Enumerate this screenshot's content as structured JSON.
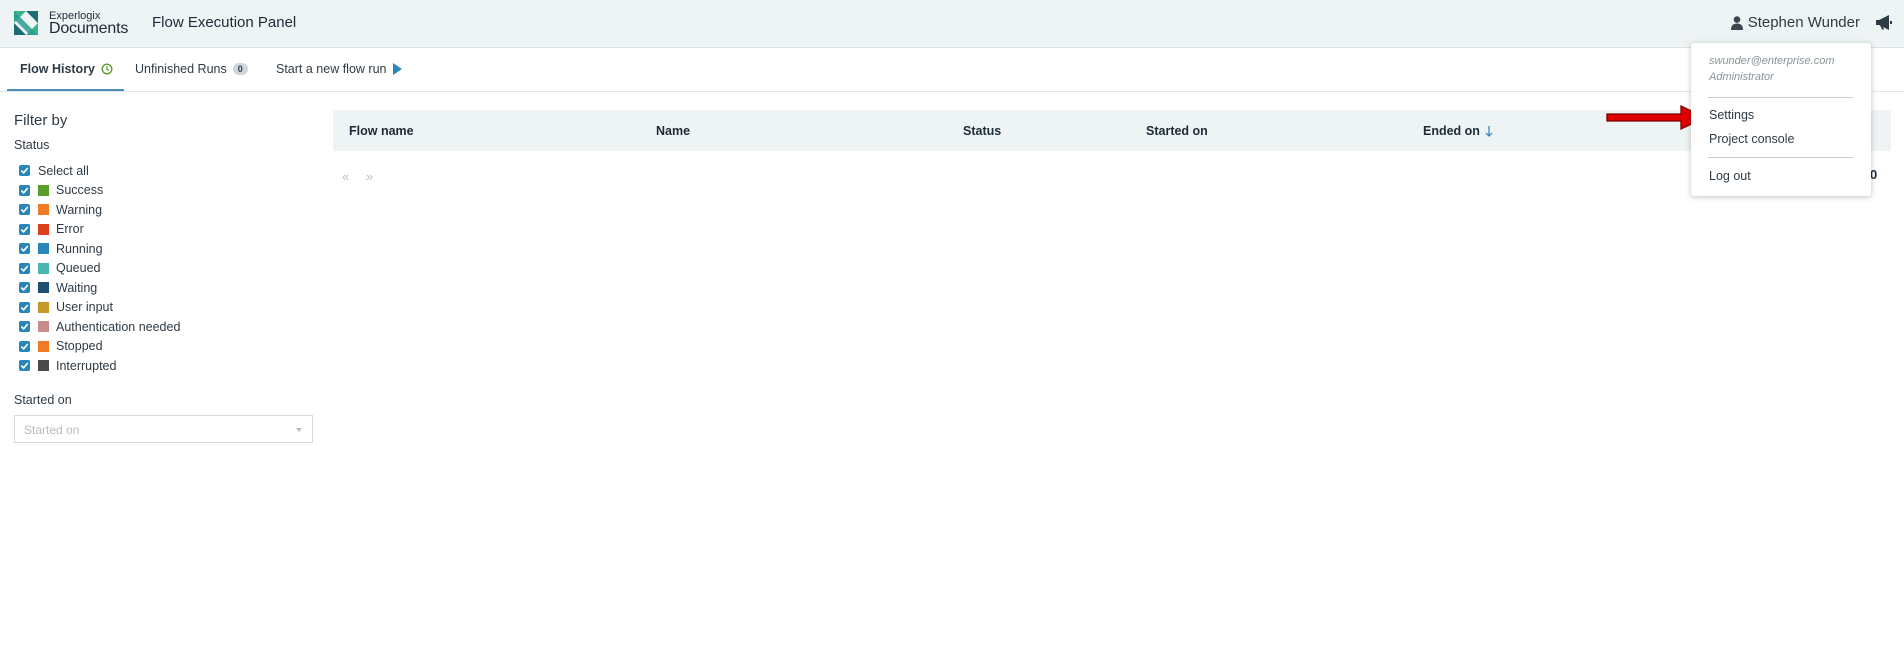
{
  "header": {
    "brand_small": "Experlogix",
    "brand_big": "Documents",
    "app_title": "Flow Execution Panel",
    "user_name": "Stephen Wunder",
    "user_icon": "user-icon",
    "announce_icon": "megaphone-icon"
  },
  "tabs": [
    {
      "label": "Flow History",
      "icon": "clock-icon",
      "active": true
    },
    {
      "label": "Unfinished Runs",
      "badge": "0"
    },
    {
      "label": "Start a new flow run",
      "icon": "play-icon"
    }
  ],
  "filter": {
    "title": "Filter by",
    "status_label": "Status",
    "statuses": [
      {
        "label": "Select all",
        "checked": true
      },
      {
        "label": "Success",
        "color": "#5a9e2a",
        "checked": true
      },
      {
        "label": "Warning",
        "color": "#f07b25",
        "checked": true
      },
      {
        "label": "Error",
        "color": "#d9401c",
        "checked": true
      },
      {
        "label": "Running",
        "color": "#2a86b8",
        "checked": true
      },
      {
        "label": "Queued",
        "color": "#4bb5b0",
        "checked": true
      },
      {
        "label": "Waiting",
        "color": "#1f4f72",
        "checked": true
      },
      {
        "label": "User input",
        "color": "#c59a2a",
        "checked": true
      },
      {
        "label": "Authentication needed",
        "color": "#c98c8c",
        "checked": true
      },
      {
        "label": "Stopped",
        "color": "#f07b25",
        "checked": true
      },
      {
        "label": "Interrupted",
        "color": "#4a4a4a",
        "checked": true
      }
    ],
    "started_label": "Started on",
    "started_placeholder": "Started on"
  },
  "table": {
    "columns": [
      "Flow name",
      "Name",
      "Status",
      "Started on",
      "Ended on"
    ],
    "sort_column": "Ended on",
    "sort_icon": "arrow-down-icon",
    "pager_prev": "«",
    "pager_next": "»",
    "count_partial": "0"
  },
  "dropdown": {
    "email": "swunder@enterprise.com",
    "role": "Administrator",
    "items": [
      "Settings",
      "Project console",
      "Log out"
    ]
  },
  "colors": {
    "accent": "#2a86b8",
    "header_bg": "#eef3f3",
    "annotation_arrow": "#e00000"
  }
}
